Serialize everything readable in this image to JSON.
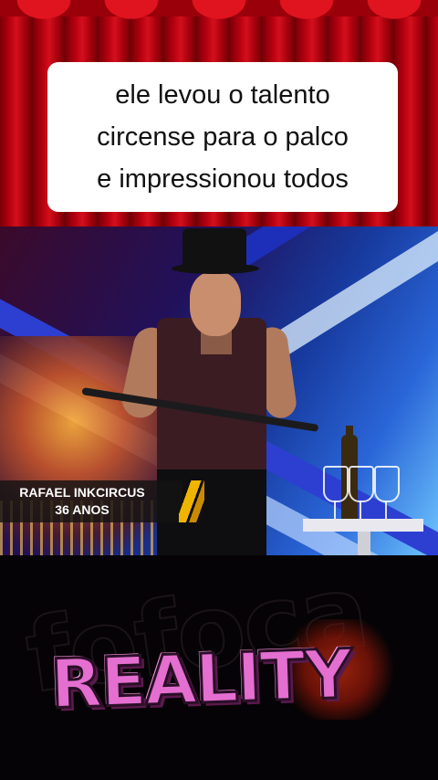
{
  "caption": {
    "lines": [
      "ele levou o talento",
      "circense para o palco",
      "e impressionou todos"
    ]
  },
  "lower_third": {
    "name": "RAFAEL INKCIRCUS",
    "age": "36 ANOS"
  },
  "brand": {
    "logo_text": "REALITY",
    "background_text": "fofoca"
  },
  "colors": {
    "curtain": "#b3000f",
    "caption_bg": "#ffffff",
    "lower_third_accent": "#f0b400",
    "logo_pink": "#e46fd0"
  }
}
